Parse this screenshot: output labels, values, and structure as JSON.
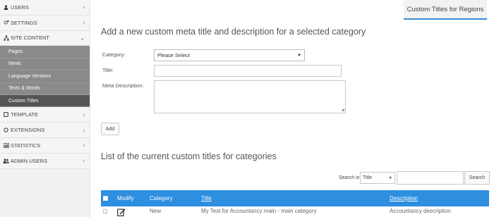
{
  "sidebar": {
    "items": [
      {
        "label": "USERS",
        "icon": "user-icon"
      },
      {
        "label": "SETTINGS",
        "icon": "cogs-icon"
      },
      {
        "label": "SITE CONTENT",
        "icon": "sitemap-icon"
      },
      {
        "label": "TEMPLATE",
        "icon": "square-icon"
      },
      {
        "label": "EXTENSIONS",
        "icon": "circle-icon"
      },
      {
        "label": "STATISTICS",
        "icon": "bar-chart-icon"
      },
      {
        "label": "ADMIN USERS",
        "icon": "users-icon"
      }
    ],
    "submenu": [
      "Pages",
      "News",
      "Language Versions",
      "Texts & Words",
      "Custom Titles"
    ],
    "active_sub": "Custom Titles"
  },
  "top_tab": "Custom Titles for Regions",
  "form": {
    "heading": "Add a new custom meta title and description for a selected category",
    "category_label": "Category:",
    "category_value": "Please Select",
    "title_label": "Title:",
    "description_label": "Meta Description:",
    "add_button": "Add"
  },
  "list": {
    "heading": "List of the current custom titles for categories",
    "search_label": "Search in:",
    "search_field_value": "Title",
    "search_button": "Search",
    "columns": [
      "Modify",
      "Category",
      "Title",
      "Description"
    ],
    "rows": [
      {
        "category": "New",
        "title": "My Test for Accountancy main - main category",
        "description": "Accountancy description"
      }
    ]
  },
  "colors": {
    "header_blue": "#2e8ee0",
    "active_tab_border": "#3a8ad6",
    "submenu_bg": "#8a8a8a",
    "submenu_active_bg": "#555555"
  }
}
